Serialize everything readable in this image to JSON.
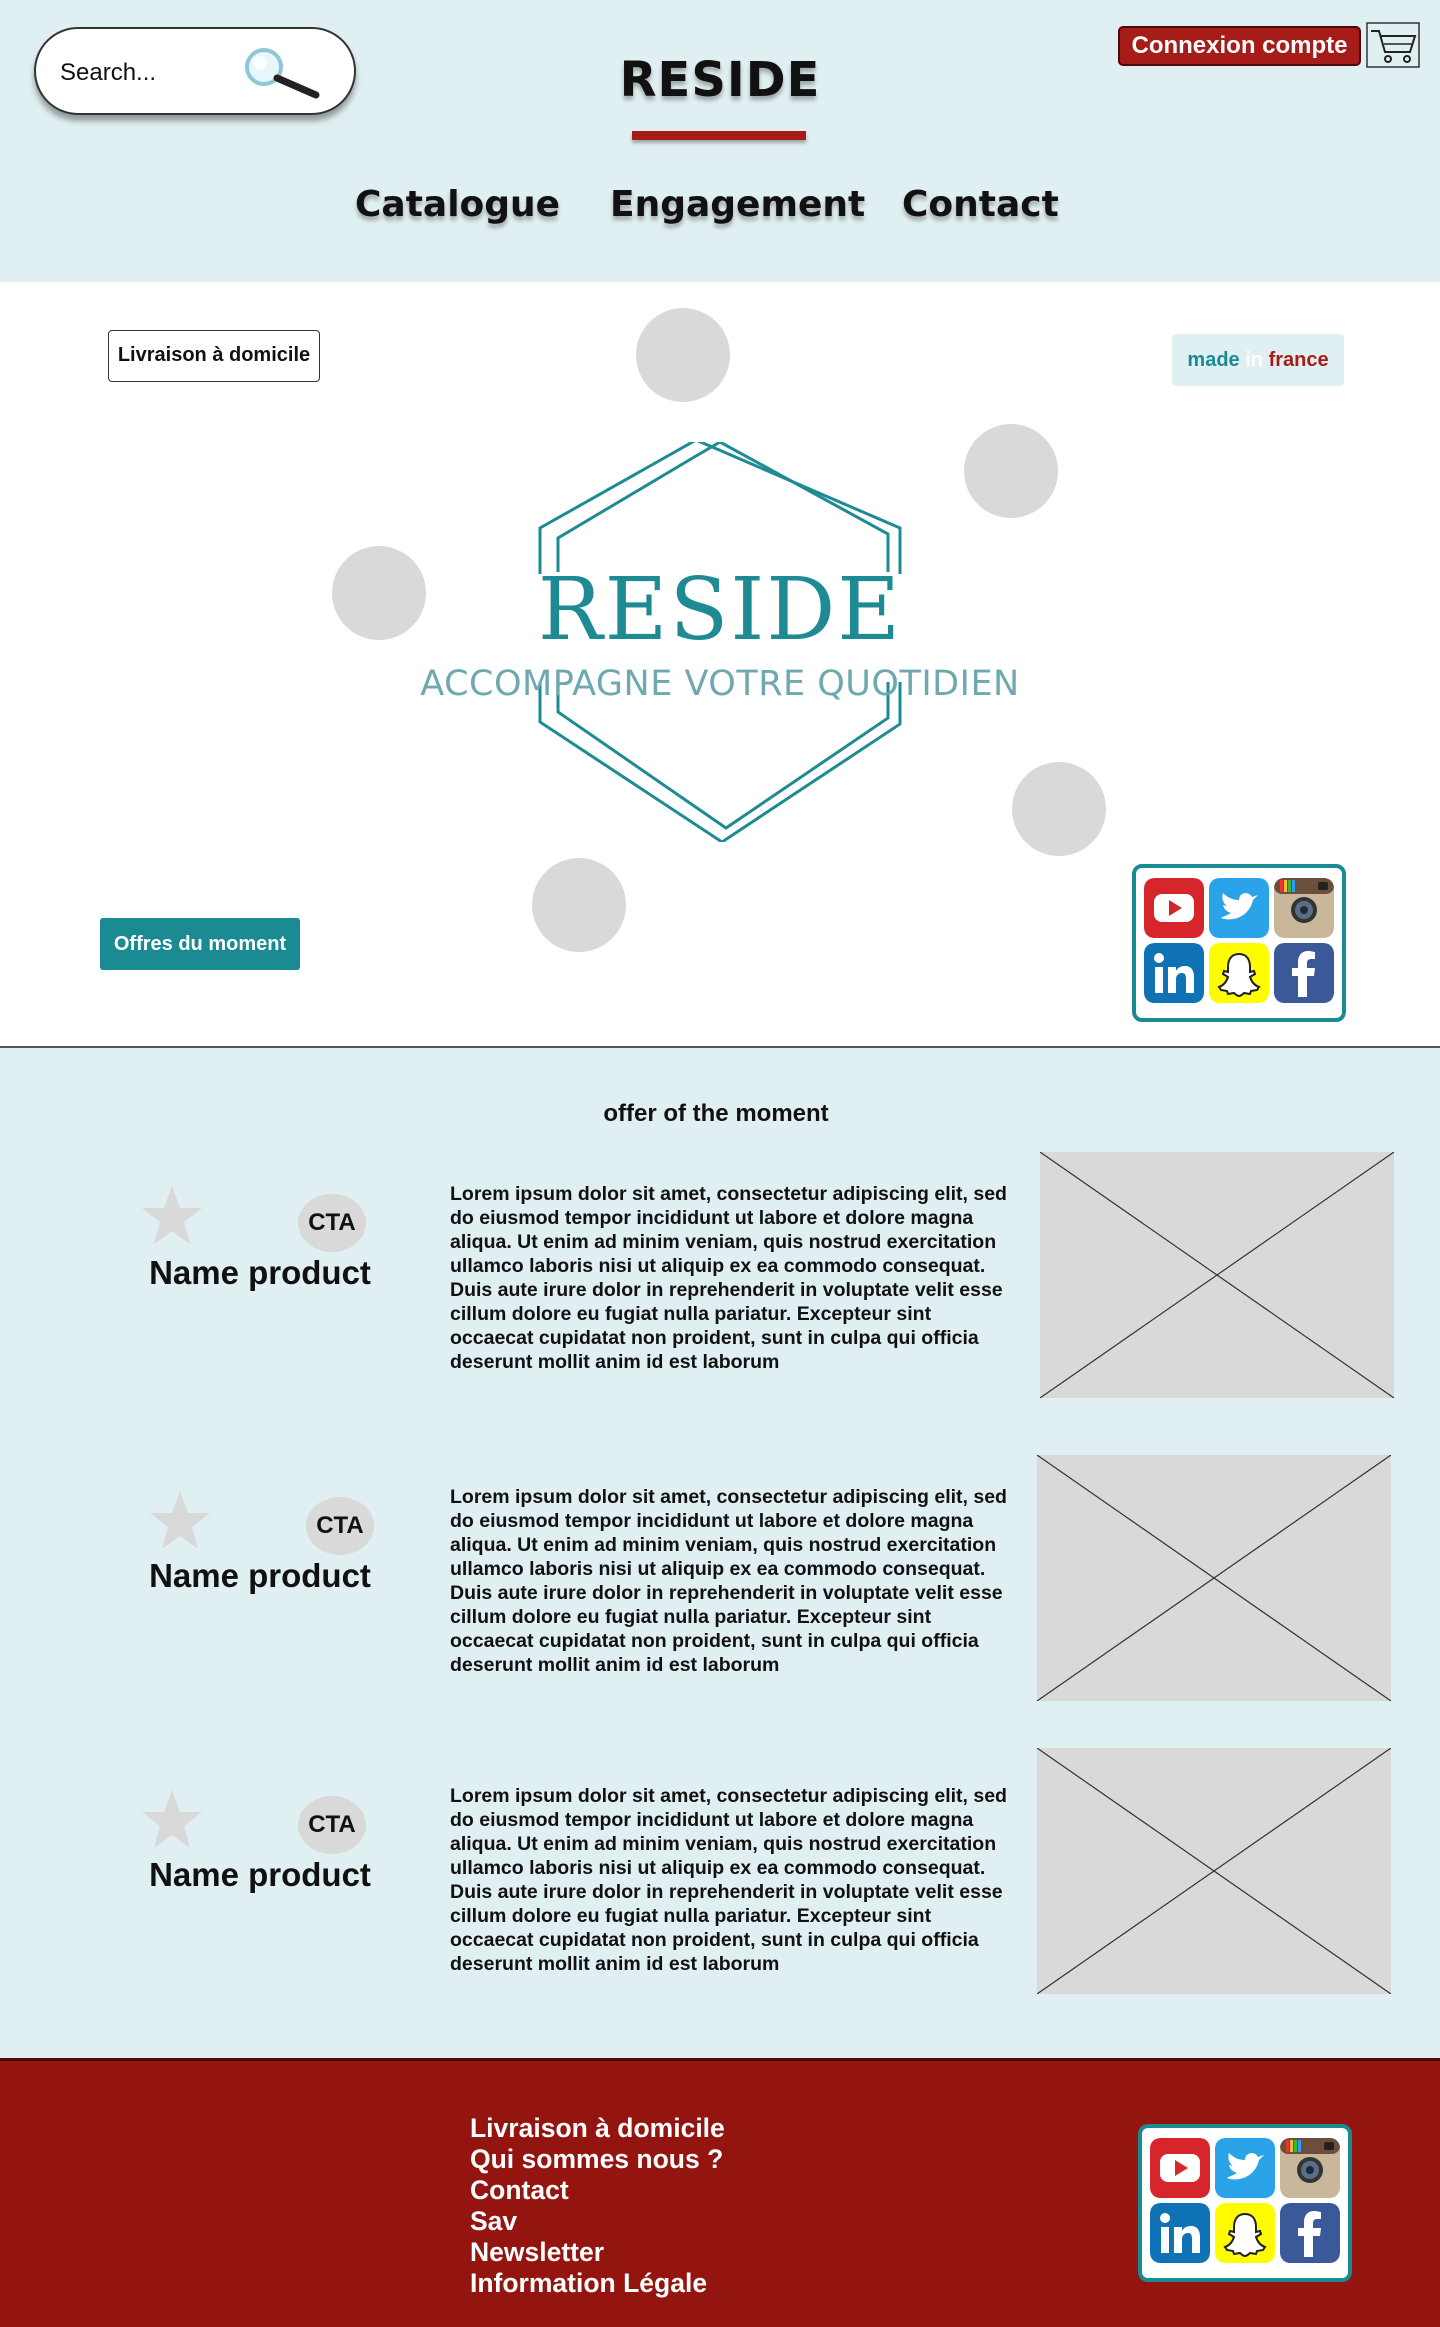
{
  "header": {
    "search_placeholder": "Search...",
    "brand": "RESIDE",
    "login_label": "Connexion compte",
    "nav": [
      "Catalogue",
      "Engagement",
      "Contact"
    ]
  },
  "hero": {
    "delivery_label": "Livraison à domicile",
    "made_in": [
      "made",
      "in",
      "france"
    ],
    "logo_title": "RESIDE",
    "logo_tagline": "ACCOMPAGNE VOTRE QUOTIDIEN",
    "offers_label": "Offres du moment"
  },
  "offers": {
    "title": "offer of the moment",
    "products": [
      {
        "name": "Name product",
        "cta": "CTA",
        "description": "Lorem ipsum dolor sit amet, consectetur adipiscing elit, sed do eiusmod tempor incididunt ut labore et dolore magna aliqua. Ut enim ad minim veniam, quis nostrud exercitation ullamco laboris nisi ut aliquip ex ea commodo consequat. Duis aute irure dolor in reprehenderit in voluptate velit esse cillum dolore eu fugiat nulla pariatur. Excepteur sint occaecat cupidatat non proident, sunt in culpa qui officia deserunt mollit anim id est laborum"
      },
      {
        "name": "Name product",
        "cta": "CTA",
        "description": "Lorem ipsum dolor sit amet, consectetur adipiscing elit, sed do eiusmod tempor incididunt ut labore et dolore magna aliqua. Ut enim ad minim veniam, quis nostrud exercitation ullamco laboris nisi ut aliquip ex ea commodo consequat. Duis aute irure dolor in reprehenderit in voluptate velit esse cillum dolore eu fugiat nulla pariatur. Excepteur sint occaecat cupidatat non proident, sunt in culpa qui officia deserunt mollit anim id est laborum"
      },
      {
        "name": "Name product",
        "cta": "CTA",
        "description": "Lorem ipsum dolor sit amet, consectetur adipiscing elit, sed do eiusmod tempor incididunt ut labore et dolore magna aliqua. Ut enim ad minim veniam, quis nostrud exercitation ullamco laboris nisi ut aliquip ex ea commodo consequat. Duis aute irure dolor in reprehenderit in voluptate velit esse cillum dolore eu fugiat nulla pariatur. Excepteur sint occaecat cupidatat non proident, sunt in culpa qui officia deserunt mollit anim id est laborum"
      }
    ]
  },
  "social": [
    "youtube-icon",
    "twitter-icon",
    "instagram-icon",
    "linkedin-icon",
    "snapchat-icon",
    "facebook-icon"
  ],
  "footer": {
    "links": [
      "Livraison à domicile",
      "Qui sommes nous ?",
      "Contact",
      "Sav",
      "Newsletter",
      "Information Légale"
    ]
  },
  "colors": {
    "accent_red": "#a51c18",
    "footer_red": "#94140f",
    "teal": "#1a8a93",
    "light_bg": "#e0eff1",
    "placeholder_grey": "#d9d9d9"
  }
}
